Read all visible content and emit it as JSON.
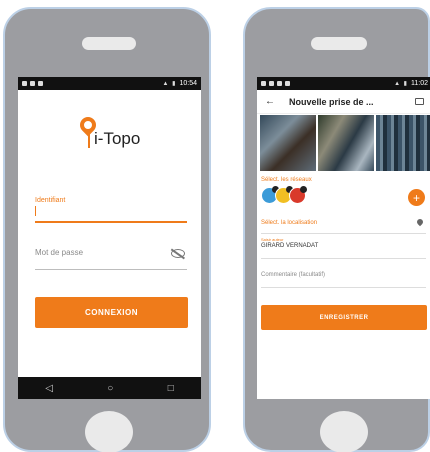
{
  "left_phone": {
    "statusbar": {
      "time": "10:54"
    },
    "app_name": "i-Topo",
    "username": {
      "label": "Identifiant",
      "value": ""
    },
    "password": {
      "placeholder": "Mot de passe"
    },
    "login_button": "CONNEXION",
    "nav": {
      "back": "◁",
      "home": "○",
      "recents": "□"
    }
  },
  "right_phone": {
    "statusbar": {
      "time": "11:02"
    },
    "toolbar": {
      "back": "←",
      "title": "Nouvelle prise de ..."
    },
    "symbols_label": "Sélect. les réseaux",
    "add_label": "+",
    "location_label": "Sélect. la localisation",
    "name": {
      "label": "Saisir auteur",
      "value": "GIRARD VERNADAT"
    },
    "comment": {
      "placeholder": "Commentaire (facultatif)"
    },
    "save_button": "ENREGISTRER"
  },
  "colors": {
    "accent": "#ef7b1a",
    "shell": "#9c9da1"
  }
}
